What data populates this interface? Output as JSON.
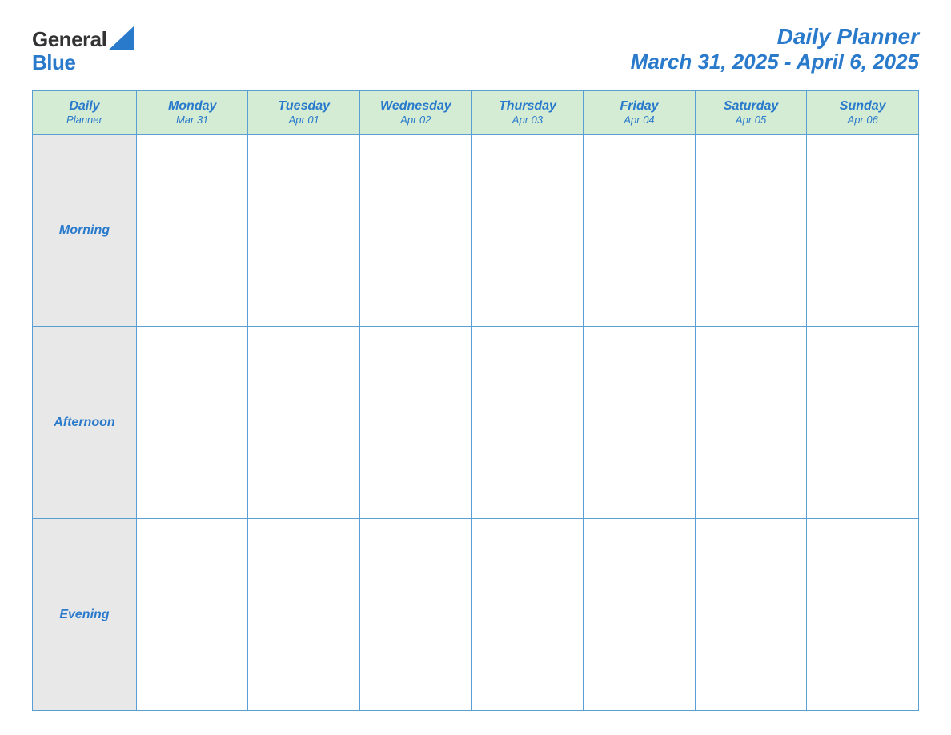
{
  "header": {
    "logo": {
      "general": "General",
      "blue": "Blue"
    },
    "title": "Daily Planner",
    "date_range": "March 31, 2025 - April 6, 2025"
  },
  "table": {
    "header_col": {
      "label_line1": "Daily",
      "label_line2": "Planner"
    },
    "days": [
      {
        "name": "Monday",
        "date": "Mar 31"
      },
      {
        "name": "Tuesday",
        "date": "Apr 01"
      },
      {
        "name": "Wednesday",
        "date": "Apr 02"
      },
      {
        "name": "Thursday",
        "date": "Apr 03"
      },
      {
        "name": "Friday",
        "date": "Apr 04"
      },
      {
        "name": "Saturday",
        "date": "Apr 05"
      },
      {
        "name": "Sunday",
        "date": "Apr 06"
      }
    ],
    "rows": [
      {
        "label": "Morning"
      },
      {
        "label": "Afternoon"
      },
      {
        "label": "Evening"
      }
    ]
  }
}
